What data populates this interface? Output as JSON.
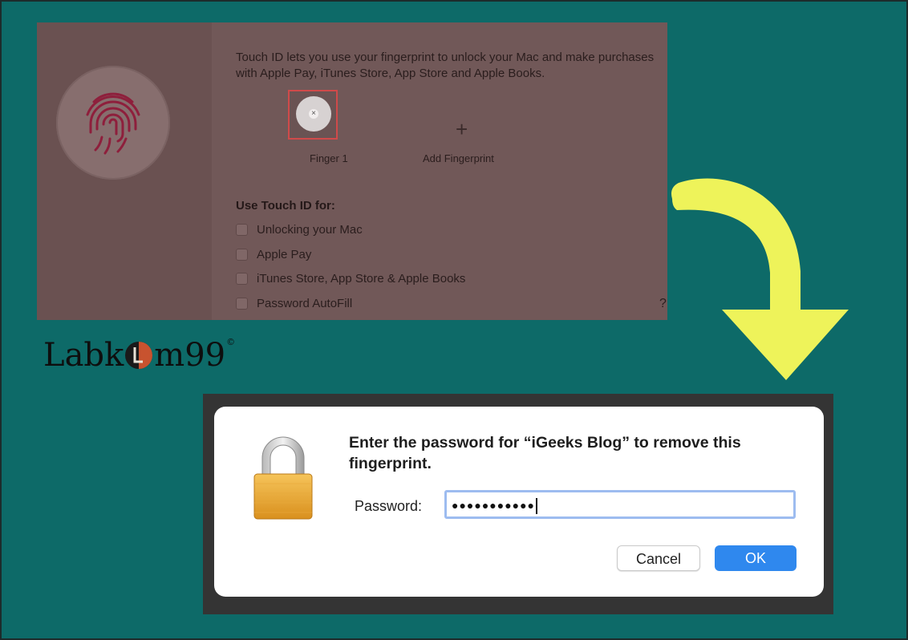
{
  "touch_id": {
    "description": "Touch ID lets you use your fingerprint to unlock your Mac and make purchases with Apple Pay, iTunes Store, App Store and Apple Books.",
    "finger_label": "Finger 1",
    "add_plus": "+",
    "add_label": "Add Fingerprint",
    "use_heading": "Use Touch ID for:",
    "options": [
      {
        "label": "Unlocking your Mac",
        "checked": false
      },
      {
        "label": "Apple Pay",
        "checked": false
      },
      {
        "label": "iTunes Store, App Store & Apple Books",
        "checked": false
      },
      {
        "label": "Password AutoFill",
        "checked": false
      }
    ],
    "help": "?",
    "remove_glyph": "×",
    "highlight_color": "#d04a4a"
  },
  "watermark": {
    "prefix": "Labk",
    "suffix": "m99",
    "copyright": "©"
  },
  "arrow": {
    "color": "#eef35a",
    "icon": "curved-down-arrow"
  },
  "dialog": {
    "title": "Enter the password for “iGeeks Blog” to remove this fingerprint.",
    "password_label": "Password:",
    "password_value": "●●●●●●●●●●●",
    "cancel_label": "Cancel",
    "ok_label": "OK",
    "ok_color": "#2f88ee",
    "icon": "padlock-icon"
  }
}
